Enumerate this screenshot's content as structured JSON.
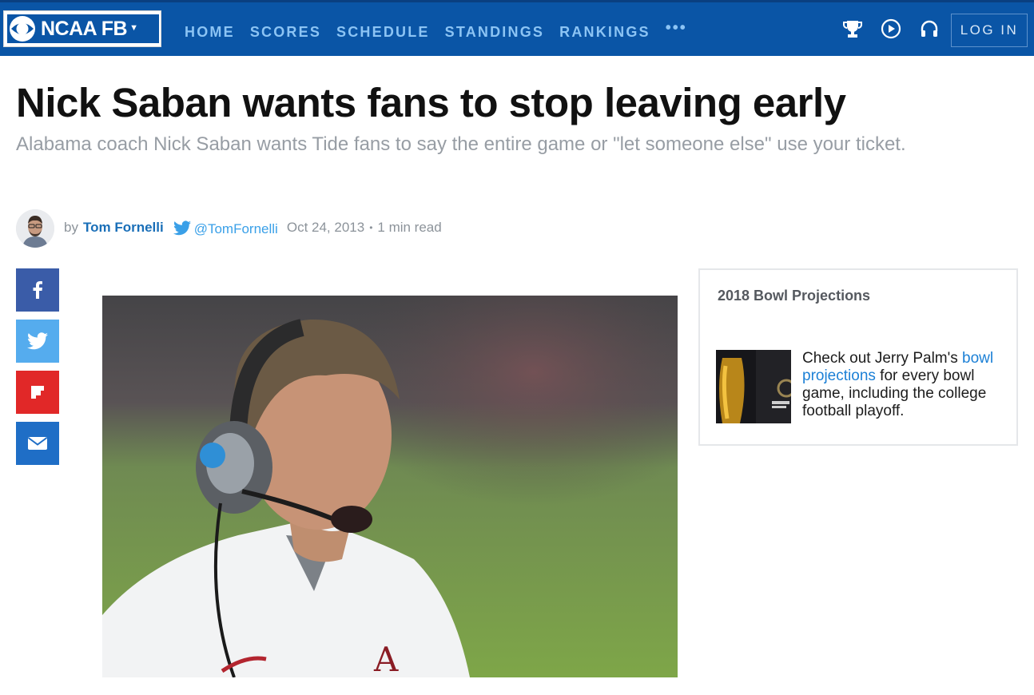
{
  "nav": {
    "logo_text": "NCAA FB",
    "links": [
      "HOME",
      "SCORES",
      "SCHEDULE",
      "STANDINGS",
      "RANKINGS"
    ],
    "more": "•••",
    "login": "LOG IN",
    "icons": [
      "trophy-icon",
      "play-icon",
      "headphones-icon"
    ]
  },
  "article": {
    "headline": "Nick Saban wants fans to stop leaving early",
    "dek": "Alabama coach Nick Saban wants Tide fans to say the entire game or \"let someone else\" use your ticket.",
    "byline": {
      "by": "by",
      "author": "Tom Fornelli",
      "handle": "@TomFornelli",
      "date": "Oct 24, 2013",
      "separator": "•",
      "read_time": "1 min read"
    }
  },
  "share": {
    "buttons": [
      "facebook-icon",
      "twitter-icon",
      "flipboard-icon",
      "email-icon"
    ],
    "colors": {
      "facebook": "#3a5ca8",
      "twitter": "#55acee",
      "flipboard": "#e12828",
      "email": "#1f6ec6"
    }
  },
  "sidebar": {
    "promo_title": "2018 Bowl Projections",
    "promo_text_before": "Check out Jerry Palm's",
    "promo_link": "bowl projections",
    "promo_text_after": "for every bowl game, including the college football playoff."
  },
  "colors": {
    "brand": "#0a55a6",
    "link": "#1c80d6",
    "author": "#1a6fb8"
  }
}
